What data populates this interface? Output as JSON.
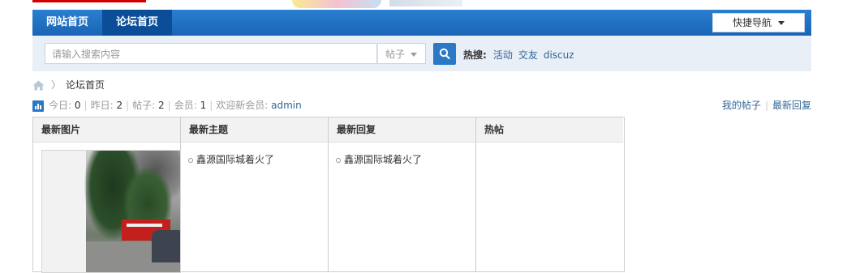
{
  "nav": {
    "items": [
      {
        "label": "网站首页"
      },
      {
        "label": "论坛首页"
      }
    ],
    "quick_nav": "快捷导航"
  },
  "search": {
    "placeholder": "请输入搜索内容",
    "type_selected": "帖子",
    "hot_label": "热搜:",
    "hot_terms": [
      "活动",
      "交友",
      "discuz"
    ]
  },
  "breadcrumb": {
    "current": "论坛首页"
  },
  "stats": {
    "today_label": "今日:",
    "today": "0",
    "yesterday_label": "昨日:",
    "yesterday": "2",
    "posts_label": "帖子:",
    "posts": "2",
    "members_label": "会员:",
    "members": "1",
    "welcome_label": "欢迎新会员:",
    "newest_member": "admin"
  },
  "links": {
    "my_posts": "我的帖子",
    "latest_replies": "最新回复"
  },
  "grid": {
    "columns": [
      {
        "title": "最新图片",
        "items": []
      },
      {
        "title": "最新主题",
        "items": [
          "鑫源国际城着火了"
        ]
      },
      {
        "title": "最新回复",
        "items": [
          "鑫源国际城着火了"
        ]
      },
      {
        "title": "热帖",
        "items": []
      }
    ]
  },
  "colors": {
    "nav_blue": "#1a64b5",
    "nav_active": "#0b4d97",
    "link": "#336699",
    "search_bar_bg": "#e8eff6"
  }
}
